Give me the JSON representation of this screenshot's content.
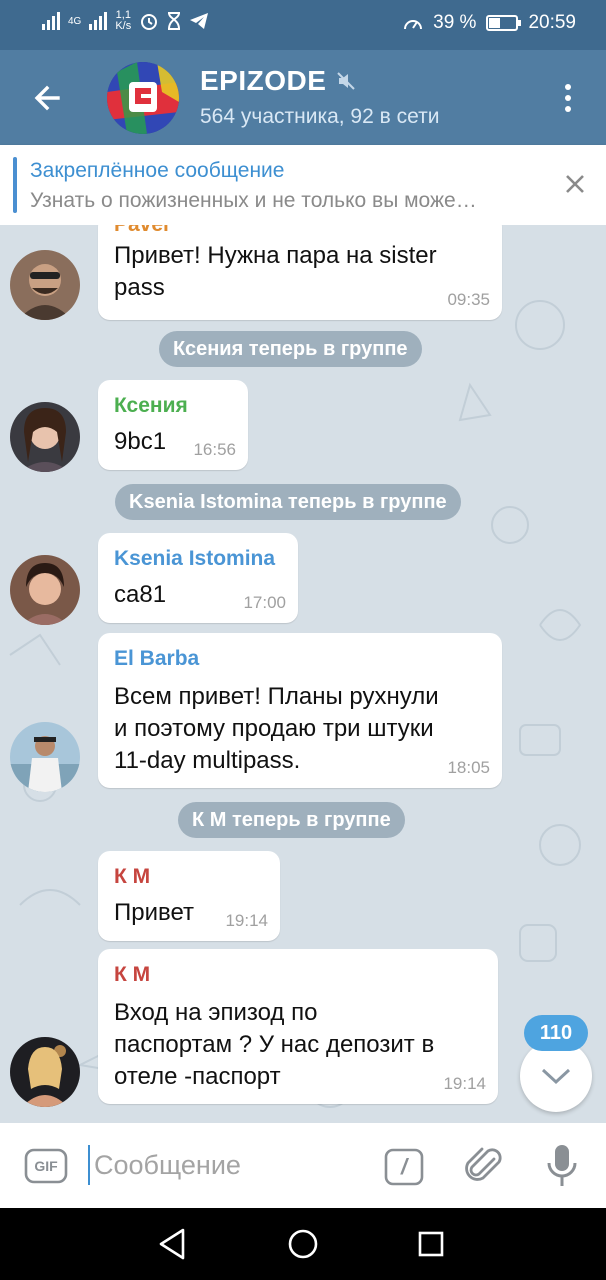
{
  "status_bar": {
    "network": "4G",
    "speed_value": "1,1",
    "speed_unit": "K/s",
    "battery": "39 %",
    "battery_level": 0.39,
    "time": "20:59"
  },
  "header": {
    "title": "EPIZODE",
    "subtitle": "564 участника, 92 в сети",
    "muted": true
  },
  "pinned": {
    "title": "Закреплённое сообщение",
    "text": "Узнать о пожизненных и не только вы може…"
  },
  "messages": [
    {
      "sender": "Pavel",
      "text_lines": [
        "Привет! Нужна пара на sister",
        "pass"
      ],
      "time": "09:35"
    },
    {
      "sender": "Ксения",
      "sender_color": "#4caf50",
      "text_lines": [
        "9bc1"
      ],
      "time": "16:56"
    },
    {
      "sender": "Ksenia Istomina",
      "sender_color": "#4a95d5",
      "text_lines": [
        "ca81"
      ],
      "time": "17:00"
    },
    {
      "sender": "El Barba",
      "sender_color": "#4a95d5",
      "text_lines": [
        "Всем привет! Планы рухнули",
        "и поэтому продаю три штуки",
        "11-day multipass."
      ],
      "time": "18:05"
    },
    {
      "sender": "К М",
      "sender_color": "#c6453f",
      "text_lines": [
        "Привет"
      ],
      "time": "19:14"
    },
    {
      "sender": "К М",
      "sender_color": "#c6453f",
      "text_lines": [
        "Вход на эпизод по",
        "паспортам ? У нас депозит в",
        "отеле -паспорт"
      ],
      "time": "19:14"
    }
  ],
  "service_messages": [
    "Ксения теперь в группе",
    "Ksenia Istomina теперь в группе",
    "К М теперь в группе"
  ],
  "unread_count": "110",
  "input": {
    "placeholder": "Сообщение",
    "gif_label": "GIF",
    "command_label": "/"
  },
  "colors": {
    "status_bar": "#3f6a8f",
    "header": "#517da2",
    "accent": "#3d8fd1",
    "badge": "#4ea4e0"
  }
}
